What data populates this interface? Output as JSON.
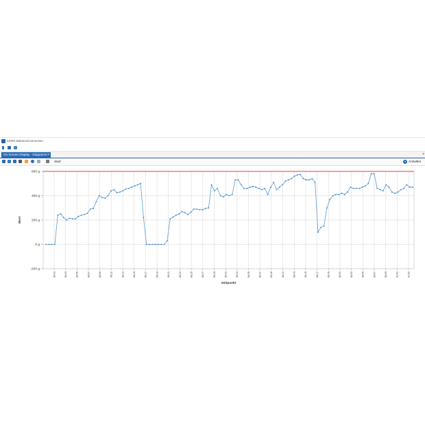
{
  "window": {
    "title": "KERN BalanceConnection"
  },
  "tab": {
    "label": "On Screen Display - Diagramm",
    "close": "×"
  },
  "subtoolbar": {
    "start_label": "Start",
    "anhalten_label": "Anhalten"
  },
  "colors": {
    "accent": "#2a6bb6",
    "series": "#5b9bd5",
    "limit_line": "#e03b3b"
  },
  "chart_data": {
    "type": "line",
    "xlabel": "Zeitpunkt",
    "ylabel": "Wert",
    "ylim": [
      -200,
      600
    ],
    "yticks": [
      "600 g",
      "400 g",
      "200 g",
      "0 g",
      "-200 g"
    ],
    "ytick_values": [
      600,
      400,
      200,
      0,
      -200
    ],
    "limit_line": 600,
    "grid": true,
    "xticks": [
      "08:01",
      "08:03",
      "08:05",
      "08:07",
      "08:09",
      "08:11",
      "08:13",
      "08:15",
      "08:17",
      "08:19",
      "08:21",
      "08:23",
      "08:25",
      "08:27",
      "08:29",
      "08:31",
      "08:33",
      "08:35",
      "08:37",
      "08:39",
      "08:41",
      "08:43",
      "08:45",
      "08:47",
      "08:49",
      "08:51",
      "08:53",
      "08:55",
      "08:57",
      "08:59",
      "01:01",
      "01:02"
    ],
    "series": [
      {
        "values": [
          0,
          0,
          0,
          0,
          240,
          250,
          220,
          200,
          215,
          210,
          210,
          230,
          240,
          245,
          255,
          290,
          295,
          350,
          400,
          385,
          380,
          400,
          440,
          450,
          425,
          430,
          440,
          455,
          460,
          470,
          480,
          490,
          500,
          220,
          0,
          0,
          0,
          0,
          0,
          0,
          0,
          30,
          210,
          225,
          240,
          250,
          270,
          260,
          245,
          265,
          290,
          290,
          285,
          285,
          295,
          300,
          490,
          440,
          460,
          400,
          390,
          410,
          400,
          410,
          530,
          530,
          490,
          460,
          460,
          470,
          475,
          470,
          460,
          450,
          460,
          410,
          470,
          510,
          450,
          470,
          490,
          520,
          530,
          540,
          560,
          570,
          575,
          540,
          530,
          530,
          540,
          510,
          100,
          140,
          150,
          300,
          370,
          400,
          410,
          410,
          420,
          410,
          430,
          470,
          460,
          460,
          460,
          470,
          480,
          500,
          580,
          580,
          460,
          450,
          440,
          490,
          470,
          430,
          420,
          430,
          450,
          460,
          490,
          470,
          470
        ]
      }
    ]
  }
}
